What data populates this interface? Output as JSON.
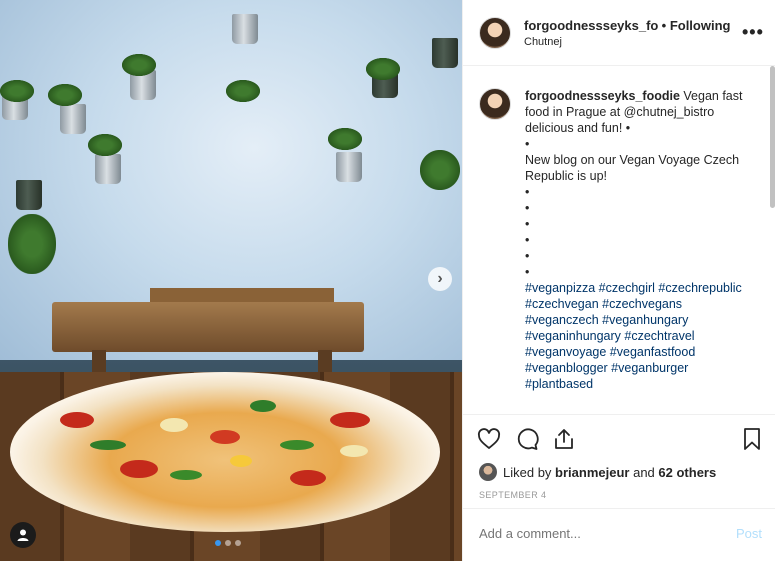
{
  "header": {
    "username": "forgoodnessseyks_foodie",
    "separator": "•",
    "follow_status": "Following",
    "location": "Chutnej",
    "more_icon": "more-options-icon"
  },
  "caption": {
    "username": "forgoodnessseyks_foodie",
    "lines": [
      "Vegan fast food in Prague at @chutnej_bistro delicious and fun! •",
      "•",
      "New blog on our Vegan Voyage Czech Republic is up!",
      "•",
      "•",
      "•",
      "•",
      "•",
      "•"
    ],
    "hashtags": "#veganpizza #czechgirl #czechrepublic #czechvegan #czechvegans #veganczech #veganhungary #veganinhungary #czechtravel #veganvoyage #veganfastfood #veganblogger #veganburger #plantbased"
  },
  "likes": {
    "prefix": "Liked by",
    "user": "brianmejeur",
    "suffix": "and",
    "others": "62 others"
  },
  "date": "SEPTEMBER 4",
  "comment": {
    "placeholder": "Add a comment...",
    "post_label": "Post"
  },
  "photo": {
    "next_arrow": "›",
    "carousel_count": 3,
    "carousel_active": 1
  },
  "colors": {
    "link": "#003569",
    "post_disabled": "#b2dffc",
    "carousel_active": "#3897f0"
  }
}
